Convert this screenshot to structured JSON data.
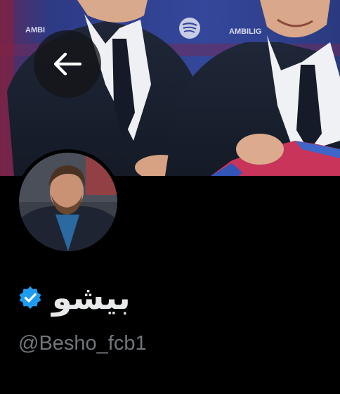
{
  "header": {
    "back_icon": "arrow-left-icon",
    "banner_logo_text_left": "AMBI",
    "banner_logo_text_right": "AMBILIG",
    "banner_logo_icon": "spotify-icon"
  },
  "profile": {
    "display_name": "بيشو",
    "verified_icon": "verified-badge-icon",
    "handle": "@Besho_fcb1"
  },
  "colors": {
    "background": "#000000",
    "name": "#e7e9ea",
    "handle": "#71767b",
    "verified": "#1d9bf0"
  }
}
